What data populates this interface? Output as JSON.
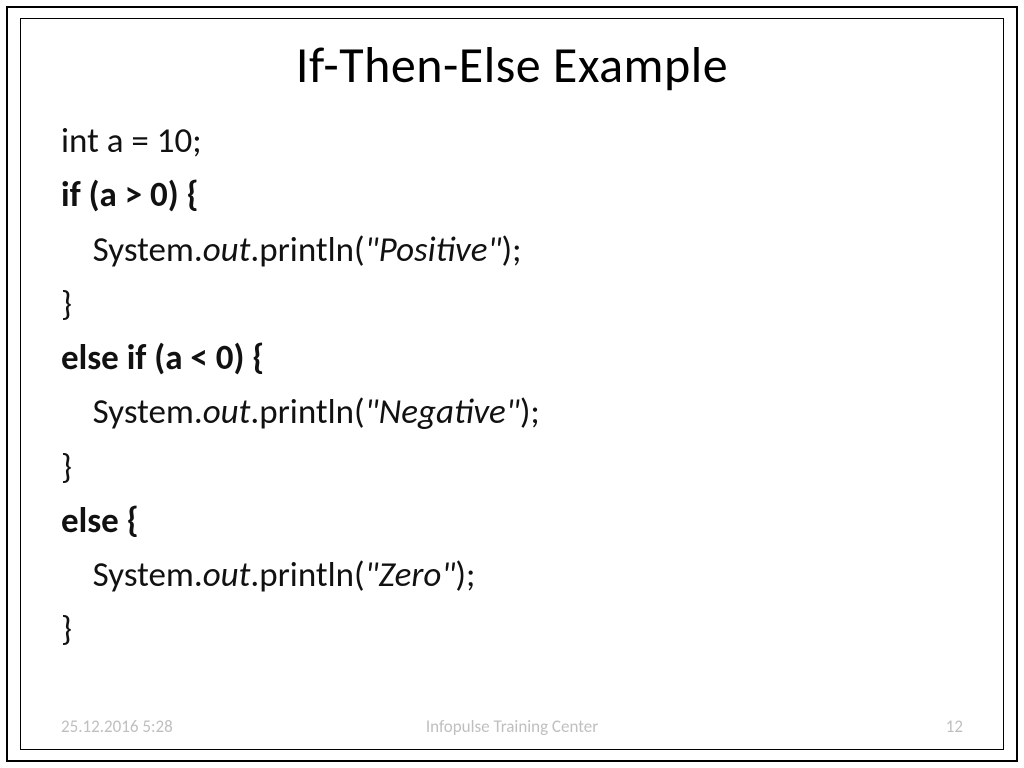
{
  "title": "If-Then-Else Example",
  "code": {
    "l1": "int a = 10;",
    "l2": "if (a > 0) {",
    "l3_pre": "    System.",
    "l3_out": "out",
    "l3_mid": ".println(",
    "l3_arg": "\"Positive\"",
    "l3_post": ");",
    "l4": "}",
    "l5": "else if (a < 0) {",
    "l6_pre": "    System.",
    "l6_out": "out",
    "l6_mid": ".println(",
    "l6_arg": "\"Negative\"",
    "l6_post": ");",
    "l7": "}",
    "l8": "else {",
    "l9_pre": "    System.",
    "l9_out": "out",
    "l9_mid": ".println(",
    "l9_arg": "\"Zero\"",
    "l9_post": ");",
    "l10": "}"
  },
  "footer": {
    "date": "25.12.2016 5:28",
    "center": "Infopulse Training Center",
    "page": "12"
  }
}
